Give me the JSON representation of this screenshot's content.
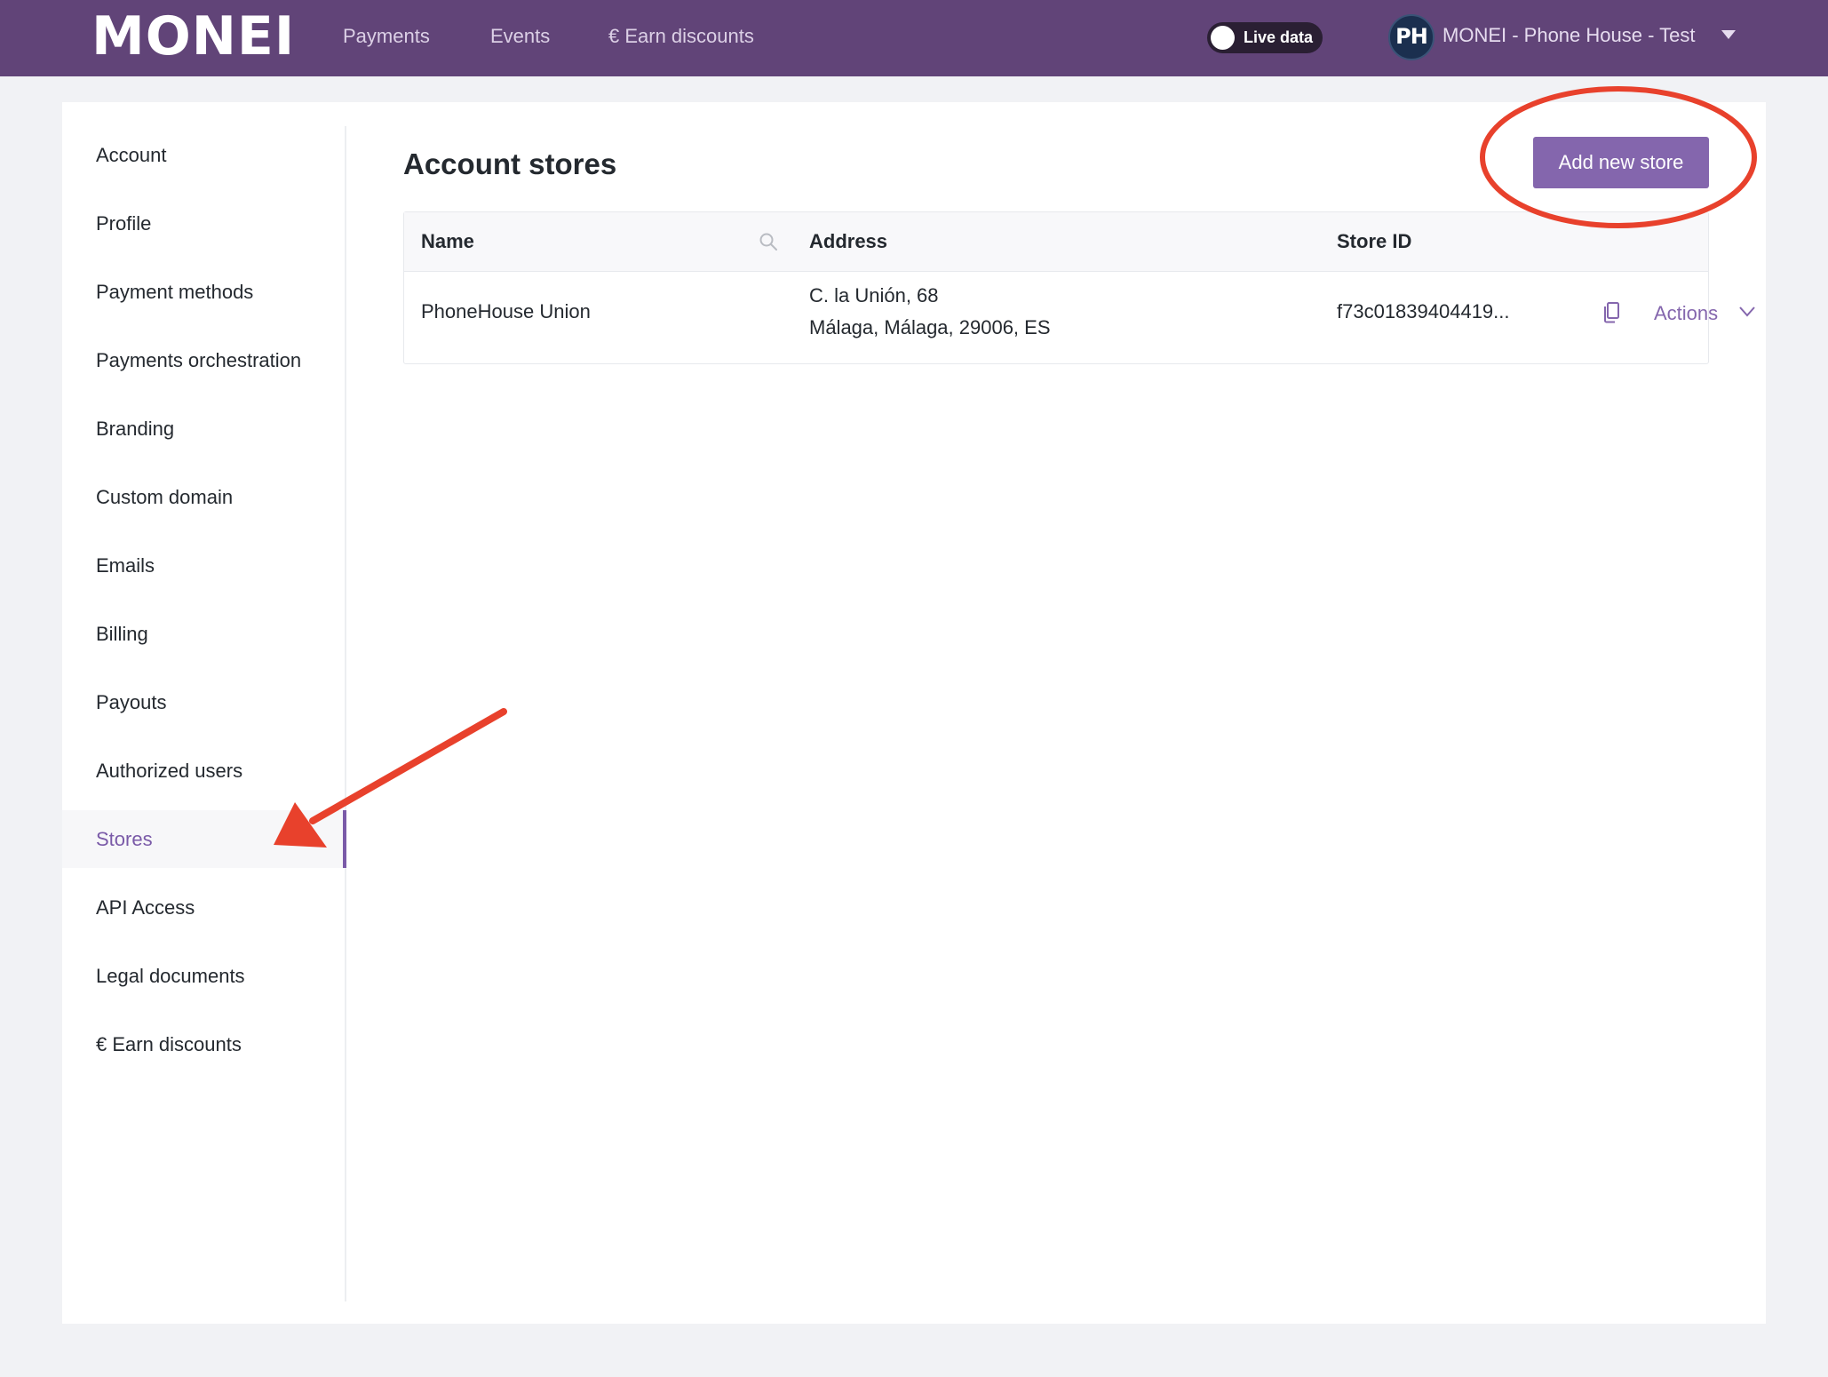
{
  "header": {
    "logo": "MONEI",
    "nav": [
      {
        "label": "Payments"
      },
      {
        "label": "Events"
      },
      {
        "label": "€ Earn discounts"
      }
    ],
    "live_toggle_label": "Live data",
    "avatar_initials": "PH",
    "account_name": "MONEI - Phone House - Test"
  },
  "sidebar": {
    "items": [
      {
        "label": "Account"
      },
      {
        "label": "Profile"
      },
      {
        "label": "Payment methods"
      },
      {
        "label": "Payments orchestration"
      },
      {
        "label": "Branding"
      },
      {
        "label": "Custom domain"
      },
      {
        "label": "Emails"
      },
      {
        "label": "Billing"
      },
      {
        "label": "Payouts"
      },
      {
        "label": "Authorized users"
      },
      {
        "label": "Stores"
      },
      {
        "label": "API Access"
      },
      {
        "label": "Legal documents"
      },
      {
        "label": "€ Earn discounts"
      }
    ],
    "active": "Stores"
  },
  "main": {
    "title": "Account stores",
    "add_button_label": "Add new store",
    "table": {
      "headers": {
        "name": "Name",
        "address": "Address",
        "store_id": "Store ID"
      },
      "rows": [
        {
          "name": "PhoneHouse Union",
          "address_line1": "C. la Unión, 68",
          "address_line2": "Málaga, Málaga, 29006, ES",
          "store_id": "f73c01839404419...",
          "actions_label": "Actions"
        }
      ]
    }
  },
  "colors": {
    "header_bg": "#614478",
    "accent": "#8466ad",
    "annotation": "#e8412c"
  }
}
